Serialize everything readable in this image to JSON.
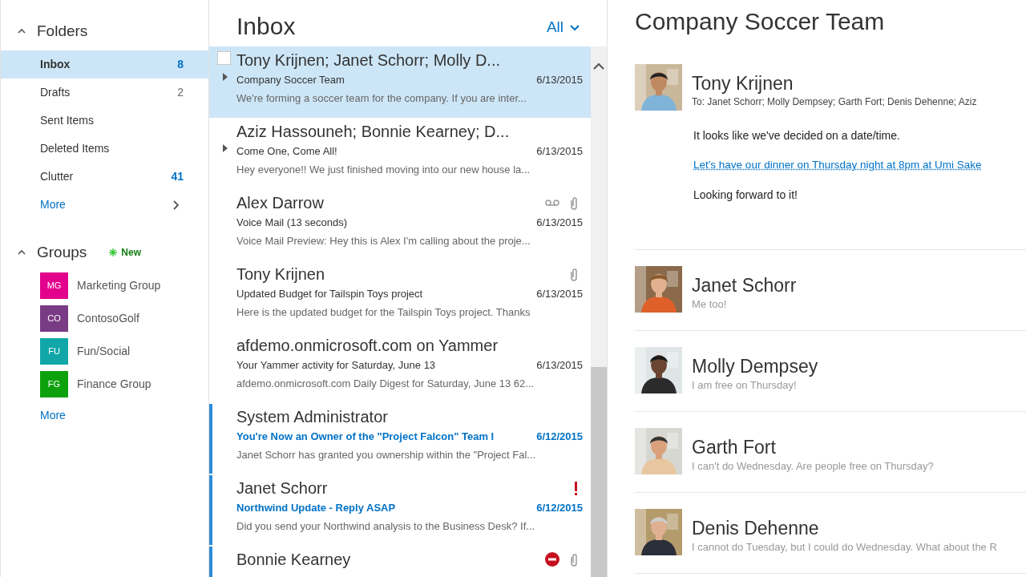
{
  "sidebar": {
    "folders_header": {
      "label": "Folders",
      "expanded": true
    },
    "folders": [
      {
        "label": "Inbox",
        "count": "8",
        "count_highlight": true,
        "selected": true
      },
      {
        "label": "Drafts",
        "count": "2",
        "count_highlight": false,
        "selected": false
      },
      {
        "label": "Sent Items",
        "selected": false
      },
      {
        "label": "Deleted Items",
        "selected": false
      },
      {
        "label": "Clutter",
        "count": "41",
        "count_highlight": true,
        "selected": false
      }
    ],
    "folders_more": "More",
    "groups_header": {
      "label": "Groups",
      "expanded": true,
      "new_label": "New"
    },
    "groups": [
      {
        "initials": "MG",
        "label": "Marketing Group",
        "color": "#e3008c"
      },
      {
        "initials": "CO",
        "label": "ContosoGolf",
        "color": "#7a3b85"
      },
      {
        "initials": "FU",
        "label": "Fun/Social",
        "color": "#11a7a8"
      },
      {
        "initials": "FG",
        "label": "Finance Group",
        "color": "#0ea10e"
      }
    ],
    "groups_more": "More"
  },
  "message_list": {
    "title": "Inbox",
    "filter": "All",
    "messages": [
      {
        "sender": "Tony Krijnen; Janet Schorr; Molly D...",
        "subject": "Company Soccer Team",
        "date": "6/13/2015",
        "preview": "We're forming a soccer team for the company. If you are inter...",
        "selected": true,
        "unread": false,
        "thread": true
      },
      {
        "sender": "Aziz Hassouneh; Bonnie Kearney; D...",
        "subject": "Come One, Come All!",
        "date": "6/13/2015",
        "preview": "Hey everyone!! We just finished moving into our new house la...",
        "selected": false,
        "unread": false,
        "thread": true
      },
      {
        "sender": "Alex Darrow",
        "subject": "Voice Mail (13 seconds)",
        "date": "6/13/2015",
        "preview": "Voice Mail Preview: Hey this is Alex I'm calling about the proje...",
        "selected": false,
        "unread": false,
        "thread": false,
        "voicemail": true,
        "attachment": true
      },
      {
        "sender": "Tony Krijnen",
        "subject": "Updated Budget for Tailspin Toys project",
        "date": "6/13/2015",
        "preview": "Here is the updated budget for the Tailspin Toys project. Thanks",
        "selected": false,
        "unread": false,
        "thread": false,
        "attachment": true
      },
      {
        "sender": "afdemo.onmicrosoft.com on Yammer",
        "subject": "Your Yammer activity for Saturday, June 13",
        "date": "6/13/2015",
        "preview": "afdemo.onmicrosoft.com Daily Digest for Saturday, June 13 62...",
        "selected": false,
        "unread": false,
        "thread": false
      },
      {
        "sender": "System Administrator",
        "subject": "You're Now an Owner of the \"Project Falcon\" Team I",
        "date": "6/12/2015",
        "preview": "Janet Schorr has granted you ownership within the \"Project Fal...",
        "selected": false,
        "unread": true,
        "thread": false
      },
      {
        "sender": "Janet Schorr",
        "subject": "Northwind Update - Reply ASAP",
        "date": "6/12/2015",
        "preview": "Did you send your Northwind analysis to the Business Desk? If...",
        "selected": false,
        "unread": true,
        "thread": false,
        "important": true
      },
      {
        "sender": "Bonnie Kearney",
        "selected": false,
        "unread": true,
        "thread": false,
        "blocked": true,
        "attachment": true
      }
    ]
  },
  "reading_pane": {
    "title": "Company Soccer Team",
    "messages": [
      {
        "sender": "Tony Krijnen",
        "expanded": true,
        "to": "To:  Janet Schorr; Molly Dempsey; Garth Fort; Denis Dehenne; Aziz",
        "body": [
          {
            "kind": "text",
            "text": "It looks like we've decided on a date/time."
          },
          {
            "kind": "link",
            "text": "Let's have our dinner on Thursday night at 8pm at Umi Sake"
          },
          {
            "kind": "text",
            "text": "Looking forward to it!"
          }
        ]
      },
      {
        "sender": "Janet Schorr",
        "expanded": false,
        "preview": "Me too!"
      },
      {
        "sender": "Molly Dempsey",
        "expanded": false,
        "preview": "I am free on Thursday!"
      },
      {
        "sender": "Garth Fort",
        "expanded": false,
        "preview": "I can't do Wednesday. Are people free on Thursday?"
      },
      {
        "sender": "Denis Dehenne",
        "expanded": false,
        "preview": "I cannot do Tuesday, but I could do Wednesday. What about the R"
      }
    ]
  }
}
